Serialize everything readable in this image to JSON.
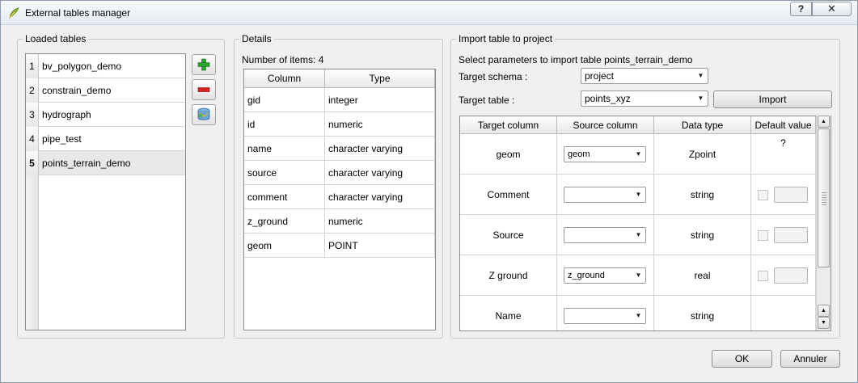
{
  "window": {
    "title": "External tables manager",
    "help_label": "?",
    "close_label": "✕"
  },
  "loaded_tables": {
    "title": "Loaded tables",
    "items": [
      {
        "num": "1",
        "label": "bv_polygon_demo"
      },
      {
        "num": "2",
        "label": "constrain_demo"
      },
      {
        "num": "3",
        "label": "hydrograph"
      },
      {
        "num": "4",
        "label": "pipe_test"
      },
      {
        "num": "5",
        "label": "points_terrain_demo"
      }
    ],
    "selected_index": 4,
    "add_icon": "plus-icon",
    "remove_icon": "minus-icon",
    "load_icon": "database-icon"
  },
  "details": {
    "title": "Details",
    "count_label": "Number of items: 4",
    "headers": [
      "Column",
      "Type"
    ],
    "rows": [
      [
        "gid",
        "integer"
      ],
      [
        "id",
        "numeric"
      ],
      [
        "name",
        "character varying"
      ],
      [
        "source",
        "character varying"
      ],
      [
        "comment",
        "character varying"
      ],
      [
        "z_ground",
        "numeric"
      ],
      [
        "geom",
        "POINT"
      ]
    ]
  },
  "import": {
    "title": "Import table to project",
    "instruction": "Select parameters to import table points_terrain_demo",
    "schema_label": "Target schema :",
    "schema_value": "project",
    "table_label": "Target table :",
    "table_value": "points_xyz",
    "import_button": "Import",
    "headers": [
      "Target column",
      "Source column",
      "Data type",
      "Default value ?"
    ],
    "rows": [
      {
        "target": "geom",
        "source": "geom",
        "type": "Zpoint",
        "has_default": false
      },
      {
        "target": "Comment",
        "source": "",
        "type": "string",
        "has_default": true
      },
      {
        "target": "Source",
        "source": "",
        "type": "string",
        "has_default": true
      },
      {
        "target": "Z ground",
        "source": "z_ground",
        "type": "real",
        "has_default": true
      },
      {
        "target": "Name",
        "source": "",
        "type": "string",
        "has_default": false
      }
    ]
  },
  "footer": {
    "ok_label": "OK",
    "cancel_label": "Annuler"
  }
}
